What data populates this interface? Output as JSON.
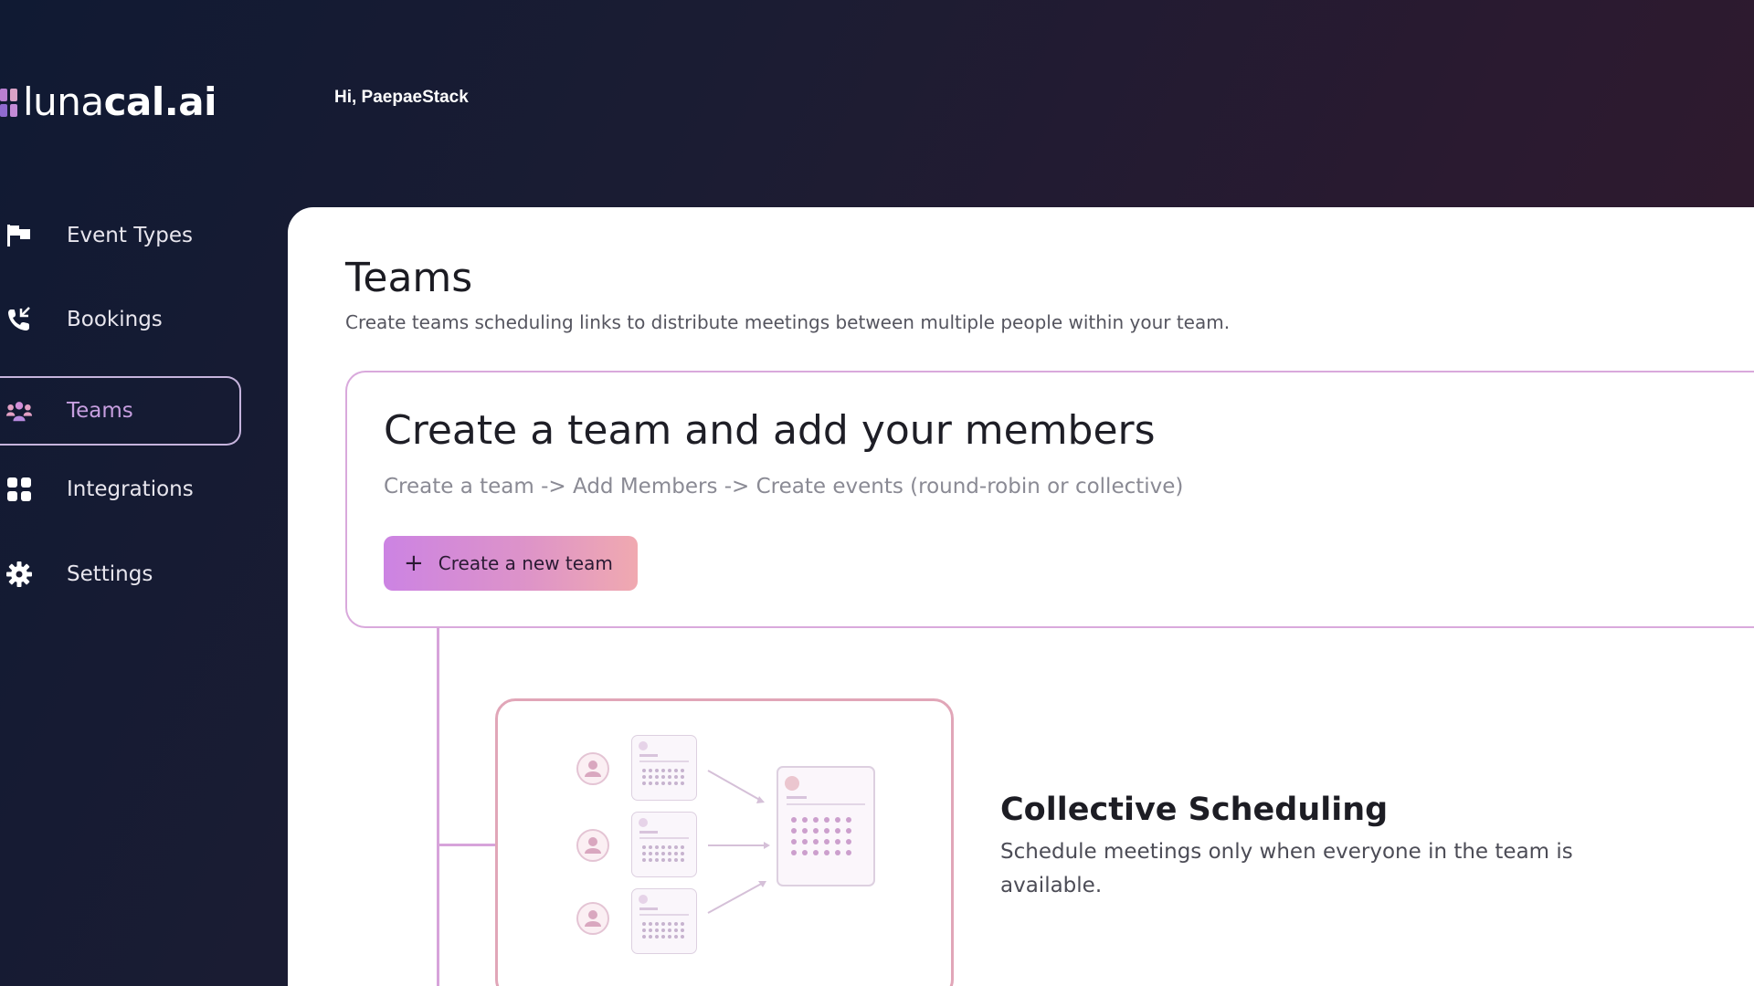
{
  "app": {
    "logo_text_light": "luna",
    "logo_text_bold": "cal.ai",
    "greeting": "Hi, PaepaeStack"
  },
  "sidebar": {
    "items": [
      {
        "label": "Event Types",
        "icon": "flag-icon",
        "active": false
      },
      {
        "label": "Bookings",
        "icon": "phone-icon",
        "active": false
      },
      {
        "label": "Teams",
        "icon": "team-icon",
        "active": true
      },
      {
        "label": "Integrations",
        "icon": "grid-icon",
        "active": false
      },
      {
        "label": "Settings",
        "icon": "gear-icon",
        "active": false
      }
    ]
  },
  "main": {
    "title": "Teams",
    "subtitle": "Create teams scheduling links to distribute meetings between multiple people within your team.",
    "create_card": {
      "heading": "Create a team and add your members",
      "steps": "Create a team -> Add Members -> Create events (round-robin or collective)",
      "button_icon": "+",
      "button_label": "Create a new team"
    },
    "feature": {
      "title": "Collective Scheduling",
      "description": "Schedule meetings only when everyone in the team is available."
    }
  },
  "colors": {
    "accent": "#c79fe0",
    "button_gradient_start": "#cc83e3",
    "button_gradient_end": "#f0a9b0",
    "card_border": "#d9a9dc"
  }
}
